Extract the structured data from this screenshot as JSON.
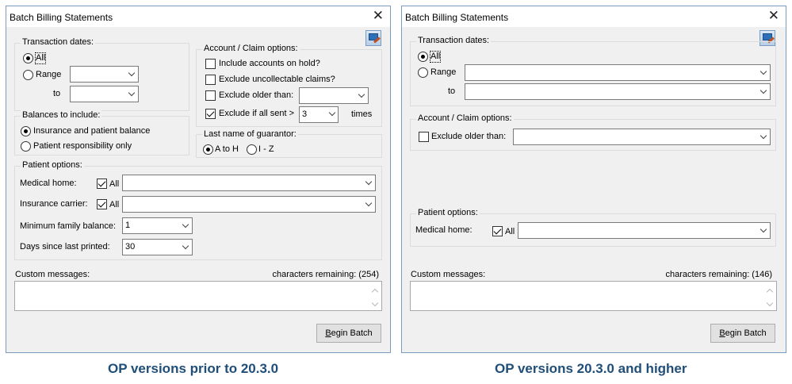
{
  "left_window": {
    "title": "Batch Billing Statements",
    "close_glyph": "✕",
    "transaction_dates": {
      "label": "Transaction dates:",
      "all_label": "All",
      "range_label": "Range",
      "to_label": "to",
      "selected": "All"
    },
    "balances": {
      "label": "Balances to include:",
      "option_1": "Insurance and patient balance",
      "option_2": "Patient responsibility only",
      "selected": "Insurance and patient balance"
    },
    "account_claim": {
      "label": "Account / Claim options:",
      "include_on_hold": "Include accounts on hold?",
      "exclude_uncollectable": "Exclude uncollectable claims?",
      "exclude_older_than": "Exclude older than:",
      "exclude_if_sent": "Exclude if all sent >",
      "exclude_if_sent_value": "3",
      "times_label": "times",
      "exclude_if_sent_checked": true
    },
    "guarantor": {
      "label": "Last name of guarantor:",
      "option_1": "A to H",
      "option_2": "I - Z",
      "selected": "A to H"
    },
    "patient_options": {
      "label": "Patient options:",
      "medical_home_label": "Medical home:",
      "insurance_carrier_label": "Insurance carrier:",
      "all_label": "All",
      "min_family_balance_label": "Minimum family balance:",
      "min_family_balance_value": "1",
      "days_since_printed_label": "Days since last printed:",
      "days_since_printed_value": "30"
    },
    "custom_messages": {
      "label": "Custom messages:",
      "chars_remaining": "characters remaining: (254)"
    },
    "begin_batch_prefix": "B",
    "begin_batch_rest": "egin Batch"
  },
  "right_window": {
    "title": "Batch Billing Statements",
    "close_glyph": "✕",
    "transaction_dates": {
      "label": "Transaction dates:",
      "all_label": "All",
      "range_label": "Range",
      "to_label": "to",
      "selected": "All"
    },
    "account_claim": {
      "label": "Account / Claim options:",
      "exclude_older_than": "Exclude older than:"
    },
    "patient_options": {
      "label": "Patient options:",
      "medical_home_label": "Medical home:",
      "all_label": "All"
    },
    "custom_messages": {
      "label": "Custom messages:",
      "chars_remaining": "characters remaining: (146)"
    },
    "begin_batch_prefix": "B",
    "begin_batch_rest": "egin Batch"
  },
  "captions": {
    "left": "OP versions prior to 20.3.0",
    "right": "OP versions 20.3.0 and higher"
  },
  "icons": {
    "settings_tool": "computer-edit-icon",
    "dropdown": "chevron-down-icon",
    "close": "close-icon"
  }
}
